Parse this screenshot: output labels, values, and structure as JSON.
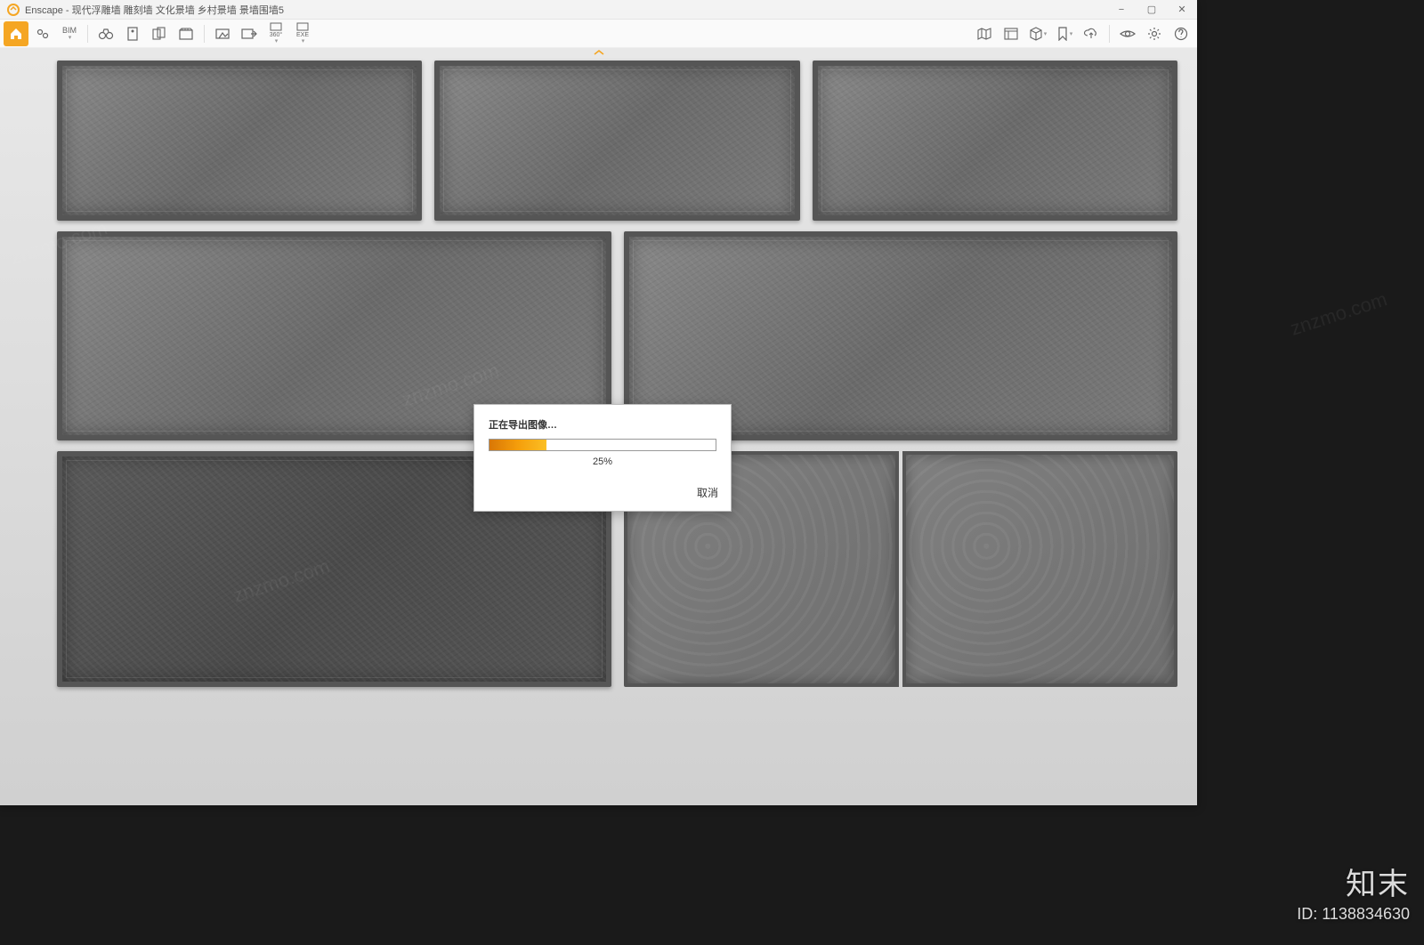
{
  "window": {
    "app_name": "Enscape",
    "title_sep": " - ",
    "document": "现代浮雕墙 雕刻墙 文化景墙 乡村景墙 景墙围墙5"
  },
  "win_controls": {
    "minimize": "−",
    "maximize": "▢",
    "close": "✕"
  },
  "toolbar": {
    "home_icon": "home-icon",
    "pin_icon": "pin-icon",
    "bim_label": "BIM",
    "binoculars": "binoculars-icon",
    "doc_icon": "single-page-icon",
    "pages_icon": "multi-page-icon",
    "clapper": "clapperboard-icon",
    "screenshot": "screenshot-icon",
    "screenshot_export": "screenshot-export-icon",
    "pano_label": "360°",
    "exe_label": "EXE",
    "right": {
      "map": "map-icon",
      "assets": "assets-icon",
      "box": "cube-icon",
      "bookmark": "bookmark-icon",
      "cloud": "upload-icon",
      "eye": "eye-icon",
      "settings": "gear-icon",
      "help": "help-icon"
    }
  },
  "dialog": {
    "message": "正在导出图像…",
    "percent_value": 25,
    "percent_text": "25%",
    "cancel": "取消"
  },
  "watermark": {
    "brand": "知末",
    "id_label": "ID: ",
    "id_value": "1138834630",
    "diag": "znzmo.com"
  },
  "colors": {
    "accent": "#f5a623",
    "progress_start": "#d97706",
    "progress_end": "#fbbf24"
  }
}
